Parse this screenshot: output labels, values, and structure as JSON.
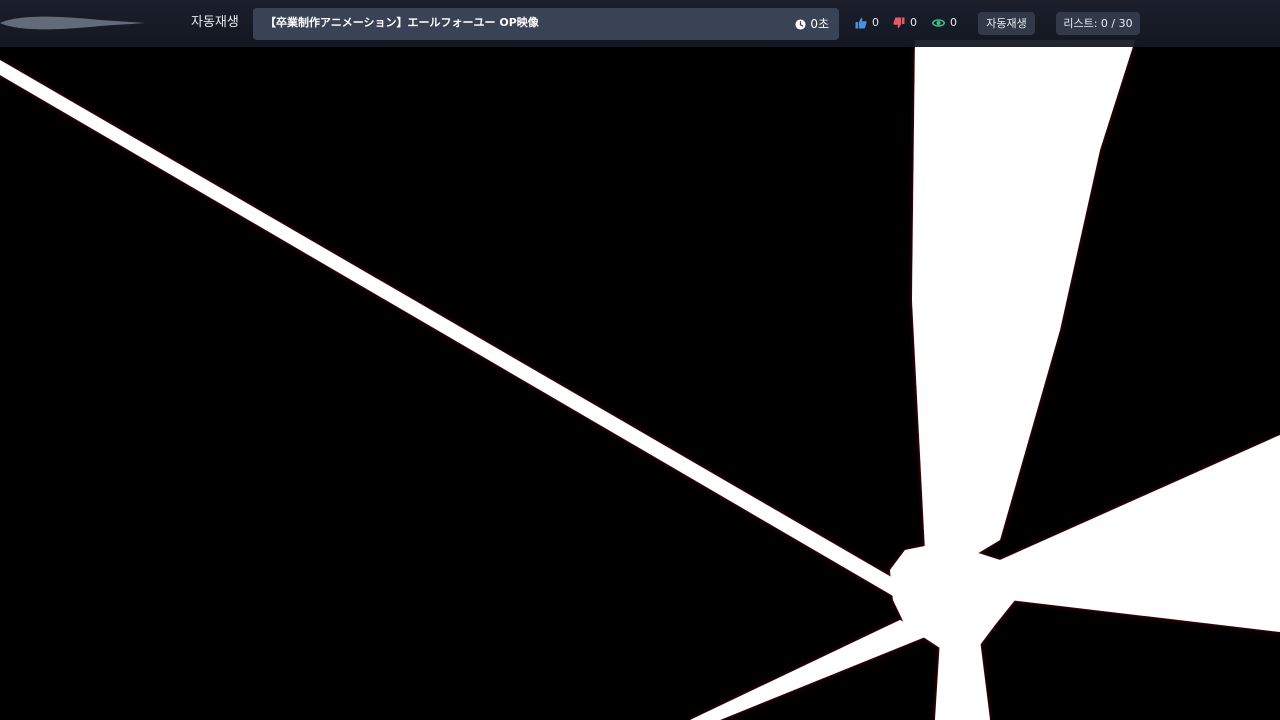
{
  "header": {
    "autoplay_label": "자동재생",
    "video_title": "【卒業制作アニメーション】エールフォーユー OP映像",
    "duration": "0초",
    "likes": "0",
    "dislikes": "0",
    "views": "0",
    "autoplay_button": "자동재생",
    "playlist_label": "리스트: 0 / 30"
  },
  "colors": {
    "like_icon": "#4a90e2",
    "dislike_icon": "#e25b6a",
    "view_icon": "#3cc28a",
    "topbar": "#1c212e",
    "title_box": "#3a4355"
  },
  "icons": {
    "duration": "clock-icon",
    "likes": "thumbs-up-icon",
    "dislikes": "thumbs-down-icon",
    "views": "eye-icon"
  }
}
